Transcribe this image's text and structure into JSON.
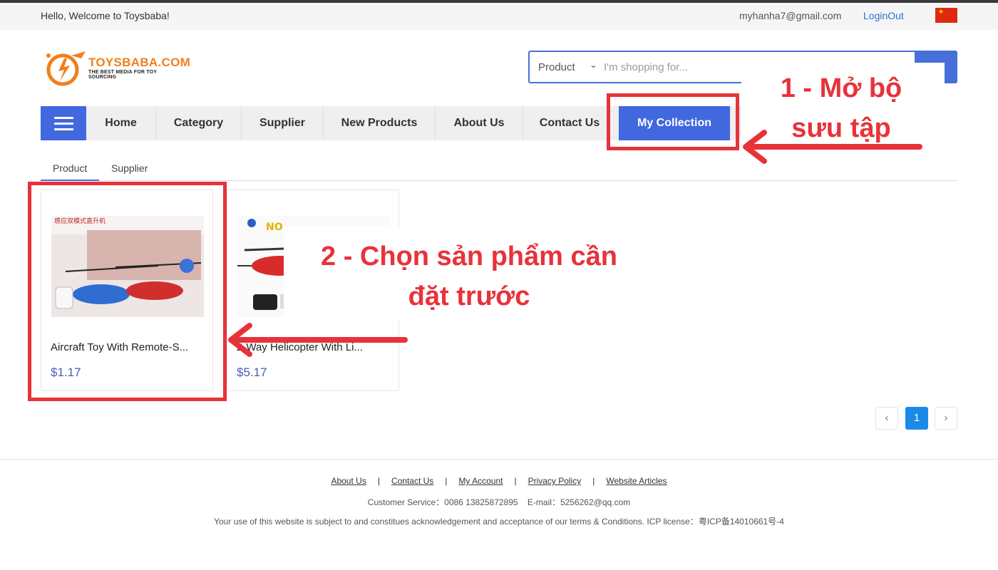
{
  "topbar": {
    "welcome": "Hello, Welcome to Toysbaba!",
    "email": "myhanha7@gmail.com",
    "logout": "LoginOut",
    "flag_icon": "china-flag-icon"
  },
  "logo": {
    "name": "TOYSBABA.COM",
    "tagline": "THE BEST MEDIA FOR TOY SOURCING"
  },
  "search": {
    "category": "Product",
    "placeholder": "I'm shopping for..."
  },
  "nav": {
    "items": [
      "Home",
      "Category",
      "Supplier",
      "New Products",
      "About Us",
      "Contact Us"
    ],
    "active": "My Collection"
  },
  "tabs": [
    "Product",
    "Supplier"
  ],
  "products": [
    {
      "title": "Aircraft Toy With Remote-S...",
      "price": "$1.17",
      "image_text": "感应双模式直升机"
    },
    {
      "title": "2-Way Helicopter With Li...",
      "price": "$5.17",
      "image_text": "NO"
    }
  ],
  "pagination": {
    "prev": "‹",
    "current": "1",
    "next": "›"
  },
  "footer": {
    "links": [
      "About Us",
      "Contact Us",
      "My Account",
      "Privacy Policy",
      "Website Articles"
    ],
    "service": "Customer Service：0086 13825872895    E-mail：5256262@qq.com",
    "terms": "Your use of this website is subject to and constitues acknowledgement and acceptance of our terms & Conditions. ICP license：粤ICP备14010661号-4"
  },
  "annotations": {
    "step1_line1": "1 - Mở bộ",
    "step1_line2": "sưu tập",
    "step2_line1": "2 - Chọn sản phẩm cần",
    "step2_line2": "đặt trước"
  },
  "colors": {
    "accent": "#4168df",
    "annotation": "#e8323a",
    "logo": "#f07f1c",
    "price": "#4a5bb5"
  }
}
